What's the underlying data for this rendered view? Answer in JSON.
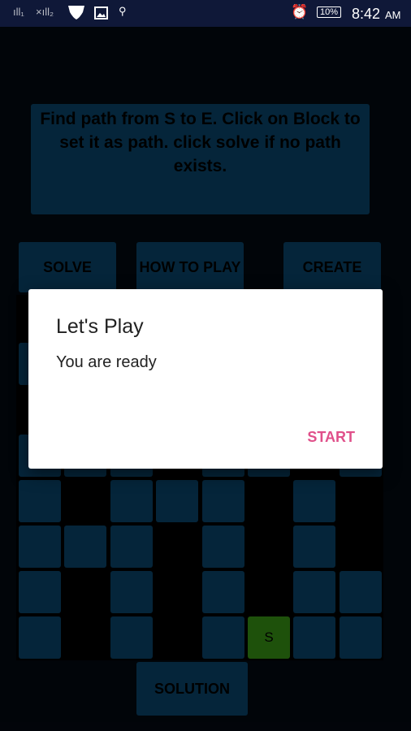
{
  "status_bar": {
    "signal1": "ıll₁",
    "signal2": "×ıll₂",
    "battery": "10%",
    "time": "8:42",
    "ampm": "AM",
    "icons": [
      "signal-icon",
      "shield-icon",
      "image-icon",
      "usb-icon",
      "alarm-icon",
      "battery-icon"
    ]
  },
  "instructions": "Find path from S to E. Click on Block to set it as path. click solve  if no path exists.",
  "buttons": {
    "solve": "SOLVE",
    "how_to_play": "HOW TO PLAY",
    "create": "CREATE",
    "solution": "SOLUTION"
  },
  "grid": {
    "rows": [
      [
        0,
        0,
        0,
        0,
        0,
        0,
        0,
        0
      ],
      [
        1,
        0,
        0,
        0,
        0,
        0,
        0,
        0
      ],
      [
        0,
        0,
        0,
        0,
        0,
        0,
        0,
        0
      ],
      [
        1,
        1,
        1,
        0,
        1,
        1,
        0,
        1
      ],
      [
        1,
        0,
        1,
        1,
        1,
        0,
        1,
        0
      ],
      [
        1,
        1,
        1,
        0,
        1,
        0,
        1,
        0
      ],
      [
        1,
        0,
        1,
        0,
        1,
        0,
        1,
        1
      ],
      [
        1,
        0,
        1,
        0,
        1,
        "S",
        1,
        1
      ]
    ],
    "start_label": "S",
    "start_color": "#2f7d12",
    "block_color": "#083a5a"
  },
  "dialog": {
    "title": "Let's Play",
    "message": "You are ready",
    "action": "START",
    "action_color": "#e0508a"
  }
}
